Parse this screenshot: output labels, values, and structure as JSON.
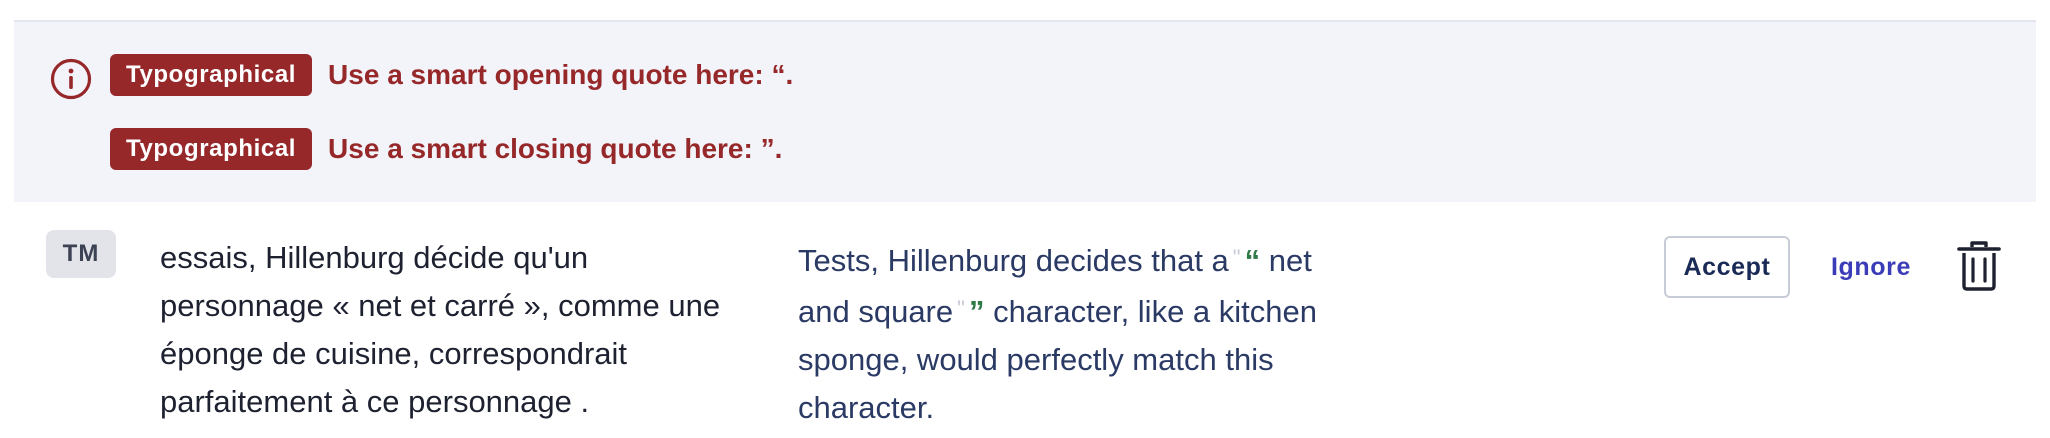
{
  "issues": [
    {
      "category": "Typographical",
      "message": "Use a smart opening quote here: “."
    },
    {
      "category": "Typographical",
      "message": "Use a smart closing quote here: ”."
    }
  ],
  "segment": {
    "tm_badge": "TM",
    "source": {
      "line1": "essais, Hillenburg décide qu'un",
      "line2": "personnage «  net et carré  », comme une",
      "line3": "éponge de cuisine, correspondrait",
      "line4": "parfaitement à ce personnage ."
    },
    "target": {
      "part1": "Tests, Hillenburg decides that a",
      "placeholder1": "\"",
      "quote_open": "“",
      "part2": "net",
      "part3": "and square",
      "placeholder2": "\"",
      "quote_close": "”",
      "part4": "character, like a kitchen",
      "line3": "sponge, would perfectly match this",
      "line4": "character."
    }
  },
  "actions": {
    "accept_label": "Accept",
    "ignore_label": "Ignore"
  },
  "icons": {
    "info": "info-circle-icon",
    "delete": "trash-icon"
  },
  "colors": {
    "error": "#96282a",
    "panel_bg": "#f3f4fa",
    "link": "#3b3db8",
    "quote_highlight": "#2f7a47"
  }
}
